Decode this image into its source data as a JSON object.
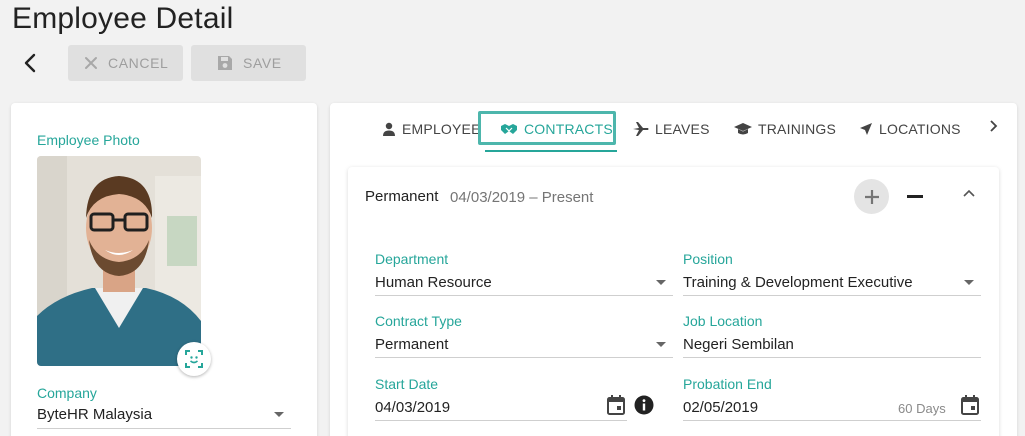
{
  "header": {
    "title": "Employee Detail"
  },
  "toolbar": {
    "cancel_label": "CANCEL",
    "save_label": "SAVE"
  },
  "profile": {
    "photo_label": "Employee Photo",
    "company_label": "Company",
    "company_value": "ByteHR Malaysia"
  },
  "tabs": [
    {
      "label": "EMPLOYEE",
      "icon": "person-icon"
    },
    {
      "label": "CONTRACTS",
      "icon": "handshake-icon",
      "active": true
    },
    {
      "label": "LEAVES",
      "icon": "airplane-icon"
    },
    {
      "label": "TRAININGS",
      "icon": "graduation-cap-icon"
    },
    {
      "label": "LOCATIONS",
      "icon": "navigation-icon"
    }
  ],
  "contract": {
    "title": "Permanent",
    "period": "04/03/2019 – Present",
    "department_label": "Department",
    "department_value": "Human Resource",
    "position_label": "Position",
    "position_value": "Training & Development Executive",
    "contract_type_label": "Contract Type",
    "contract_type_value": "Permanent",
    "job_location_label": "Job Location",
    "job_location_value": "Negeri Sembilan",
    "start_date_label": "Start Date",
    "start_date_value": "04/03/2019",
    "probation_end_label": "Probation End",
    "probation_end_value": "02/05/2019",
    "probation_days": "60 Days"
  },
  "colors": {
    "accent": "#26a69a",
    "disabled_button": "#e0e0e0"
  }
}
